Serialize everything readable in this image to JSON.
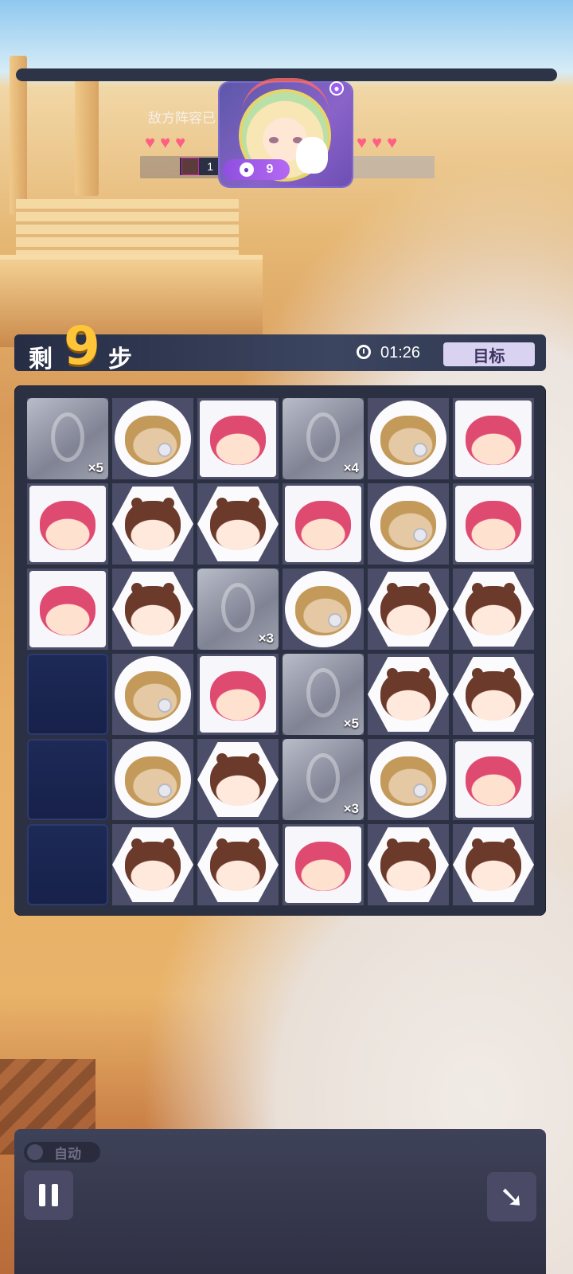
{
  "header": {
    "enemy_label": "敌方阵容已",
    "team_count": "1",
    "player_level": "9"
  },
  "steps": {
    "prefix": "剩",
    "count": "9",
    "suffix": "步",
    "timer": "01:26",
    "goal_label": "目标"
  },
  "board": {
    "rows": [
      [
        {
          "t": "stone",
          "c": "×5"
        },
        {
          "t": "tan"
        },
        {
          "t": "pink"
        },
        {
          "t": "stone",
          "c": "×4"
        },
        {
          "t": "tan"
        },
        {
          "t": "pink"
        }
      ],
      [
        {
          "t": "pink"
        },
        {
          "t": "brown"
        },
        {
          "t": "brown"
        },
        {
          "t": "pink"
        },
        {
          "t": "tan"
        },
        {
          "t": "pink"
        }
      ],
      [
        {
          "t": "pink"
        },
        {
          "t": "brown"
        },
        {
          "t": "stone",
          "c": "×3"
        },
        {
          "t": "tan"
        },
        {
          "t": "brown"
        },
        {
          "t": "brown"
        }
      ],
      [
        {
          "t": "empty"
        },
        {
          "t": "tan"
        },
        {
          "t": "pink"
        },
        {
          "t": "stone",
          "c": "×5"
        },
        {
          "t": "brown"
        },
        {
          "t": "brown"
        }
      ],
      [
        {
          "t": "empty"
        },
        {
          "t": "tan"
        },
        {
          "t": "brown"
        },
        {
          "t": "stone",
          "c": "×3"
        },
        {
          "t": "tan"
        },
        {
          "t": "pink"
        }
      ],
      [
        {
          "t": "empty"
        },
        {
          "t": "brown"
        },
        {
          "t": "brown"
        },
        {
          "t": "pink"
        },
        {
          "t": "brown"
        },
        {
          "t": "brown"
        }
      ]
    ]
  },
  "controls": {
    "auto_label": "自动",
    "pause_icon": "pause-icon",
    "exit_icon": "exit-arrow-icon"
  }
}
